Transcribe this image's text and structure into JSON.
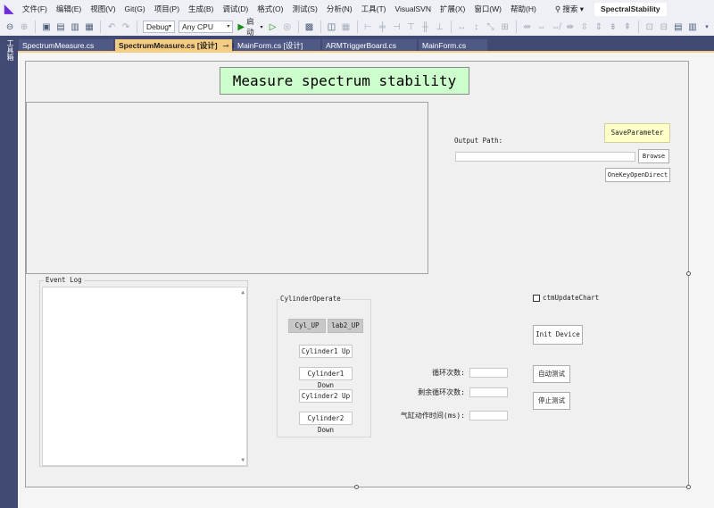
{
  "menu": {
    "logo": "◣",
    "items": [
      "文件(F)",
      "编辑(E)",
      "视图(V)",
      "Git(G)",
      "项目(P)",
      "生成(B)",
      "调试(D)",
      "格式(O)",
      "测试(S)",
      "分析(N)",
      "工具(T)",
      "VisualSVN",
      "扩展(X)",
      "窗口(W)",
      "帮助(H)"
    ],
    "search": "⚲ 搜索 ▾",
    "solution": "SpectralStability"
  },
  "toolbar": {
    "config": "Debug",
    "platform": "Any CPU",
    "run_label": "启动",
    "arrow": "▾"
  },
  "toolbox": {
    "label": "工具箱"
  },
  "tabs": [
    {
      "label": "SpectrumMeasure.cs",
      "active": false,
      "icons": ""
    },
    {
      "label": "SpectrumMeasure.cs [设计]",
      "active": true,
      "icons": "⊸ ✕"
    },
    {
      "label": "MainForm.cs [设计]",
      "active": false,
      "icons": ""
    },
    {
      "label": "ARMTriggerBoard.cs",
      "active": false,
      "icons": ""
    },
    {
      "label": "MainForm.cs",
      "active": false,
      "icons": ""
    }
  ],
  "form": {
    "title": "Measure spectrum stability",
    "output_path_label": "Output Path:",
    "save_parameter": "SaveParameter",
    "browse": "Browse",
    "one_key_open": "OneKeyOpenDirect",
    "event_log": "Event Log",
    "cylinder": {
      "legend": "CylinderOperate",
      "cyl_up": "Cyl_UP",
      "lab2_up": "lab2_UP",
      "buttons": [
        "Cylinder1 Up",
        "Cylinder1 Down",
        "Cylinder2 Up",
        "Cylinder2 Down"
      ]
    },
    "ctm_update_chart": "ctmUpdateChart",
    "init_device": "Init Device",
    "auto_test": "自动测试",
    "stop_test": "停止测试",
    "params": {
      "loop_count": "循环次数:",
      "remaining": "剩余循环次数:",
      "cylinder_time": "气缸动作时间(ms):"
    }
  }
}
